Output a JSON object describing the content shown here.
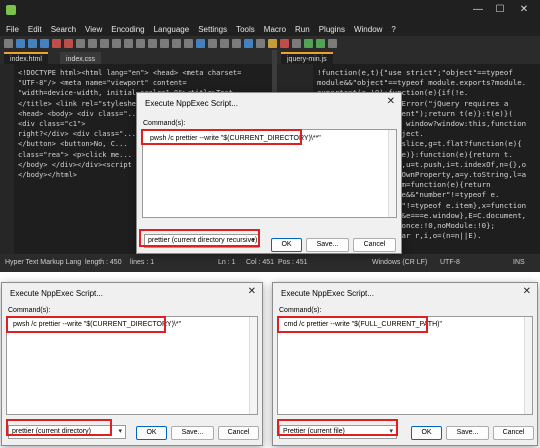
{
  "titlebar": {
    "minimize": "—",
    "maximize": "☐",
    "close": "✕"
  },
  "menu": [
    "File",
    "Edit",
    "Search",
    "View",
    "Encoding",
    "Language",
    "Settings",
    "Tools",
    "Macro",
    "Run",
    "Plugins",
    "Window",
    "?"
  ],
  "tabs_left": [
    {
      "label": "index.html"
    },
    {
      "label": "index.css"
    }
  ],
  "tabs_right": [
    {
      "label": "jquery-min.js"
    }
  ],
  "editor_left_code": "<!DOCTYPE html><html lang=\"en\"> <head> <meta charset=\n\"UTF-8\"/> <meta name=\"viewport\" content=\n\"width=device-width, initial-scale=1.0\"><title>Test\n</title> <link rel=\"stylesheet\"...\n<head> <body> <div class=\"...\n<div class=\"c1\">\nright?</div> <div class=\"...\n</button> <button>No, C...\nclass=\"rea\"> <p>click me...\n</body> </div></div><script\n</body></html>",
  "editor_right_code": "!function(e,t){\"use strict\";\"object\"==typeof\nmodule&&\"object\"==typeof module.exports?module.\nexports=t(e,!0):function(e){if(!e.\ndocument)throw new Error(\"jQuery requires a\nwindow with a document\");return t(e)}:t(e)}(\n\"undefined\"!=typeof window?window:this,function\n(e,t){var n=[],r=Object.\ngetPrototypeOf,o=n.slice,g=t.flat?function(e){\nreturn t.flat.call(e)}:function(e){return t.\nconcat.apply([],e)},u=t.push,i=t.indexOf,n={},o\n=n.toString,v=n.hasOwnProperty,a=y.toString,l=a\n.call(Object),y={},m=function(e){return\n\"function\"==typeof e&&\"number\"!=typeof e.\nnodeType&&\"function\"!=typeof e.item},x=function\n(e){return null!=e&&e===e.window},E=C.document,\nc={type:!0,src:!0,nonce:!0,noModule:!0};\nfunction b(e,t,n){var r,i,o=(n=n||E).",
  "statusbar": {
    "lang": "Hyper Text Markup Lang",
    "length": "length : 450",
    "lines": "lines : 1",
    "ln": "Ln : 1",
    "col": "Col : 451",
    "pos": "Pos : 451",
    "eol": "Windows (CR LF)",
    "enc": "UTF-8",
    "ins": "INS"
  },
  "dialog_top": {
    "title": "Execute NppExec Script...",
    "commands_label": "Command(s):",
    "command": "pwsh /c prettier --write \"$(CURRENT_DIRECTORY)\\**\"",
    "script": "prettier (current directory recursive)",
    "ok": "OK",
    "save": "Save...",
    "cancel": "Cancel"
  },
  "dialog_bl": {
    "title": "Execute NppExec Script...",
    "commands_label": "Command(s):",
    "command": "pwsh /c prettier --write \"$(CURRENT_DIRECTORY)\\*\"",
    "script": "prettier (current directory)",
    "ok": "OK",
    "save": "Save...",
    "cancel": "Cancel"
  },
  "dialog_br": {
    "title": "Execute NppExec Script...",
    "commands_label": "Command(s):",
    "command": "cmd /c prettier --write \"$(FULL_CURRENT_PATH)\"",
    "script": "Prettier (current file)",
    "ok": "OK",
    "save": "Save...",
    "cancel": "Cancel"
  },
  "colors": {
    "highlight": "#e02020",
    "editor_bg": "#1e1e1e",
    "tab_active_accent": "#f0a030"
  }
}
